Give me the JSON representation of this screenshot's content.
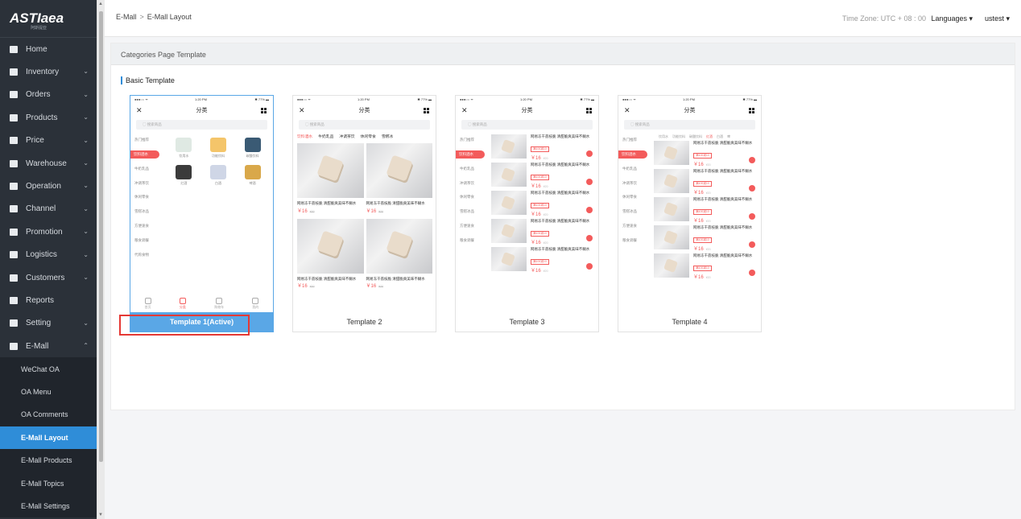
{
  "sidebar": {
    "logo_text": "ASTIaea",
    "logo_sub": "阿斯提亚",
    "items": [
      {
        "label": "Home",
        "icon": "home-icon",
        "has_chevron": false
      },
      {
        "label": "Inventory",
        "icon": "monitor-icon",
        "has_chevron": true
      },
      {
        "label": "Orders",
        "icon": "orders-icon",
        "has_chevron": true
      },
      {
        "label": "Products",
        "icon": "products-icon",
        "has_chevron": true
      },
      {
        "label": "Price",
        "icon": "price-icon",
        "has_chevron": true
      },
      {
        "label": "Warehouse",
        "icon": "warehouse-icon",
        "has_chevron": true
      },
      {
        "label": "Operation",
        "icon": "operation-icon",
        "has_chevron": true
      },
      {
        "label": "Channel",
        "icon": "channel-icon",
        "has_chevron": true
      },
      {
        "label": "Promotion",
        "icon": "promotion-icon",
        "has_chevron": true
      },
      {
        "label": "Logistics",
        "icon": "logistics-icon",
        "has_chevron": true
      },
      {
        "label": "Customers",
        "icon": "customers-icon",
        "has_chevron": true
      },
      {
        "label": "Reports",
        "icon": "reports-icon",
        "has_chevron": false
      },
      {
        "label": "Setting",
        "icon": "gear-icon",
        "has_chevron": true
      },
      {
        "label": "E-Mall",
        "icon": "mall-icon",
        "has_chevron": true,
        "expanded": true
      }
    ],
    "sub_items": [
      {
        "label": "WeChat OA",
        "active": false
      },
      {
        "label": "OA Menu",
        "active": false
      },
      {
        "label": "OA Comments",
        "active": false
      },
      {
        "label": "E-Mall Layout",
        "active": true
      },
      {
        "label": "E-Mall Products",
        "active": false
      },
      {
        "label": "E-Mall Topics",
        "active": false
      },
      {
        "label": "E-Mall Settings",
        "active": false
      }
    ]
  },
  "topbar": {
    "breadcrumb": [
      "E-Mall",
      "E-Mall Layout"
    ],
    "breadcrumb_sep": ">",
    "timezone": "Time Zone: UTC + 08 : 00",
    "languages": "Languages ▾",
    "user": "ustest ▾"
  },
  "card": {
    "header": "Categories Page Template",
    "section_title": "Basic Template"
  },
  "phone": {
    "status_left": "●●●○○ ᯤ",
    "status_time": "1:20 PM",
    "status_right": "✱ 77% ▬",
    "close": "✕",
    "title": "分类",
    "search_placeholder": "◯ 搜索商品",
    "categories": [
      "热门推荐",
      "饮料酒水",
      "牛奶乳品",
      "冲调茶饮",
      "休闲零食",
      "雪糕冰品",
      "方便速食",
      "粮食调餐",
      "代购食物"
    ],
    "categories_short": [
      "热门推荐",
      "饮料酒水",
      "牛奶乳品",
      "冲调茶饮",
      "休闲零食",
      "雪糕冰品",
      "方便速食",
      "粮食调餐"
    ],
    "active_category": "饮料酒水",
    "icon_items": [
      "饮用水",
      "功能饮料",
      "碳酸饮料",
      "红酒",
      "白酒",
      "啤酒"
    ],
    "hscroll_tabs": [
      "饮料酒水",
      "牛奶乳品",
      "冲调茶饮",
      "休闲零食",
      "雪糕冰"
    ],
    "sub_tabs": [
      "饮用水",
      "功能饮料",
      "碳酸饮料",
      "红酒",
      "白酒",
      "啤"
    ],
    "active_sub_tab": "红酒",
    "product_name": "网易冻干荔枝脆 清甜脆爽美味不糊水",
    "product_tag": "满100减10",
    "product_price": "￥16",
    "product_old_price": "¥20",
    "tabbar": [
      "首页",
      "分类",
      "购物车",
      "我的"
    ],
    "active_tab": "分类"
  },
  "templates": [
    {
      "label": "Template 1(Active)",
      "active": true
    },
    {
      "label": "Template 2",
      "active": false
    },
    {
      "label": "Template 3",
      "active": false
    },
    {
      "label": "Template 4",
      "active": false
    }
  ],
  "colors": {
    "sidebar_bg": "#2b3139",
    "accent": "#2f8dd8",
    "active_template": "#5aa7e6",
    "mall_red": "#f35b5b",
    "highlight": "#e53935"
  }
}
